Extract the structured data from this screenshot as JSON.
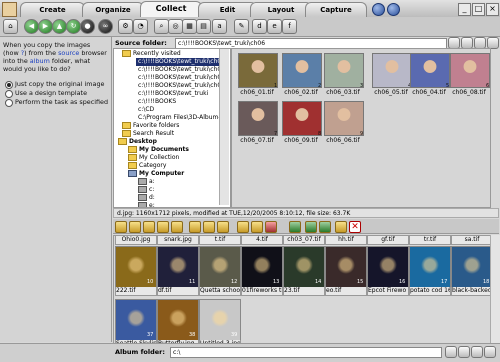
{
  "tabs": [
    {
      "label": "Create"
    },
    {
      "label": "Organize"
    },
    {
      "label": "Collect"
    },
    {
      "label": "Edit"
    },
    {
      "label": "Layout"
    },
    {
      "label": "Capture"
    }
  ],
  "active_tab": "Collect",
  "window_controls": [
    "minimize",
    "maximize",
    "close"
  ],
  "toolbar_icons": [
    "home-icon",
    "back-icon",
    "forward-icon",
    "up-icon",
    "refresh-icon",
    "copy-icon",
    "move-icon",
    "binoculars-icon",
    "settings-icon",
    "search-icon",
    "find-icon",
    "letter-a-icon",
    "letter-b-icon",
    "letter-c-icon",
    "letter-d-icon"
  ],
  "left_panel": {
    "instruction_parts": [
      "When you copy the images (how ",
      "?",
      ") from the ",
      "source",
      " browser into the ",
      "album",
      " folder, what would you like to do?"
    ],
    "options": [
      {
        "label": "Just copy the original image",
        "selected": true
      },
      {
        "label": "Use a design template",
        "selected": false
      },
      {
        "label": "Perform the task as specified",
        "selected": false
      }
    ]
  },
  "source_folder": {
    "label": "Source folder:",
    "value": "c:\\!!!!BOOKS\\tewt_truki\\ch06"
  },
  "tree": [
    {
      "label": "Recently visited",
      "selected": false,
      "bold": false,
      "indent": 1
    },
    {
      "label": "c:\\!!!!BOOKS\\tewt_truki\\ch06",
      "selected": true,
      "bold": false,
      "indent": 2
    },
    {
      "label": "c:\\!!!!BOOKS\\tewt_truki\\ch03",
      "selected": false,
      "bold": false,
      "indent": 2
    },
    {
      "label": "c:\\!!!!BOOKS\\tewt_truki\\ch04",
      "selected": false,
      "bold": false,
      "indent": 2
    },
    {
      "label": "c:\\!!!!BOOKS\\tewt_truki\\ch05",
      "selected": false,
      "bold": false,
      "indent": 2
    },
    {
      "label": "c:\\!!!!BOOKS\\tewt_truki",
      "selected": false,
      "bold": false,
      "indent": 2
    },
    {
      "label": "c:\\!!!!BOOKS",
      "selected": false,
      "bold": false,
      "indent": 2
    },
    {
      "label": "c:\\CD",
      "selected": false,
      "bold": false,
      "indent": 2
    },
    {
      "label": "C:\\Program Files\\3D-Album-",
      "selected": false,
      "bold": false,
      "indent": 2
    },
    {
      "label": "Favorite folders",
      "selected": false,
      "bold": false,
      "indent": 1
    },
    {
      "label": "Search Result",
      "selected": false,
      "bold": false,
      "indent": 1
    },
    {
      "label": "Desktop",
      "selected": false,
      "bold": true,
      "indent": 1
    },
    {
      "label": "My Documents",
      "selected": false,
      "bold": true,
      "indent": 2
    },
    {
      "label": "My Collection",
      "selected": false,
      "bold": false,
      "indent": 2
    },
    {
      "label": "Category",
      "selected": false,
      "bold": false,
      "indent": 2
    },
    {
      "label": "My Computer",
      "selected": false,
      "bold": true,
      "indent": 2
    },
    {
      "label": "a:",
      "selected": false,
      "bold": false,
      "indent": 3
    },
    {
      "label": "c:",
      "selected": false,
      "bold": false,
      "indent": 3
    },
    {
      "label": "d:",
      "selected": false,
      "bold": false,
      "indent": 3
    },
    {
      "label": "e:",
      "selected": false,
      "bold": false,
      "indent": 3
    }
  ],
  "thumbnails": [
    {
      "label": "ch06_01.tif",
      "num": "1",
      "color": "#7a6a3a"
    },
    {
      "label": "ch06_02.tif",
      "num": "2",
      "color": "#5b7fa8"
    },
    {
      "label": "ch06_03.tif",
      "num": "3",
      "color": "#a0b0a0"
    },
    {
      "label": "ch06_05.tif",
      "num": "4",
      "color": "#b8b8c8"
    },
    {
      "label": "ch06_04.tif",
      "num": "5",
      "color": "#5a6ab0"
    },
    {
      "label": "ch06_08.tif",
      "num": "6",
      "color": "#c08090"
    },
    {
      "label": "ch06_07.tif",
      "num": "7",
      "color": "#6a5a5a"
    },
    {
      "label": "ch06_09.tif",
      "num": "8",
      "color": "#a03030"
    },
    {
      "label": "ch06_06.tif",
      "num": "9",
      "color": "#c0a090"
    }
  ],
  "status_text": "d.jpg: 1160x1712 pixels, modified at TUE,12/20/2005 8:10:12, file size: 63.7K",
  "album_top_labels": [
    "Ohio0.jpg",
    "snark.jpg",
    "t.tif",
    "4.tif",
    "ch03_07.tif",
    "hh.tif",
    "gf.tif",
    "tr.tif",
    "sa.tif"
  ],
  "album_items": [
    {
      "label": "222.tif",
      "num": "10",
      "color": "#8a6a1a"
    },
    {
      "label": "df.tif",
      "num": "11",
      "color": "#20203a"
    },
    {
      "label": "Quetta schoo",
      "num": "12",
      "color": "#5a5a4a"
    },
    {
      "label": "01fireworks ti",
      "num": "13",
      "color": "#101018"
    },
    {
      "label": "23.tif",
      "num": "14",
      "color": "#2a3a2a"
    },
    {
      "label": "eo.tif",
      "num": "15",
      "color": "#3a2a2a"
    },
    {
      "label": "Epcot Firewo",
      "num": "16",
      "color": "#15152a"
    },
    {
      "label": "potato cod 16",
      "num": "17",
      "color": "#1a6aa0"
    },
    {
      "label": "black-backed",
      "num": "18",
      "color": "#2a5a8a"
    },
    {
      "label": "Seattle Skylin",
      "num": "37",
      "color": "#3a5aa0"
    },
    {
      "label": "Butterfly.jpg",
      "num": "38",
      "color": "#8a5a1a"
    },
    {
      "label": "Untitled-3.jpg",
      "num": "39",
      "color": "#c8c8c8"
    }
  ],
  "album_folder": {
    "label": "Album folder:",
    "value": "c:\\"
  }
}
